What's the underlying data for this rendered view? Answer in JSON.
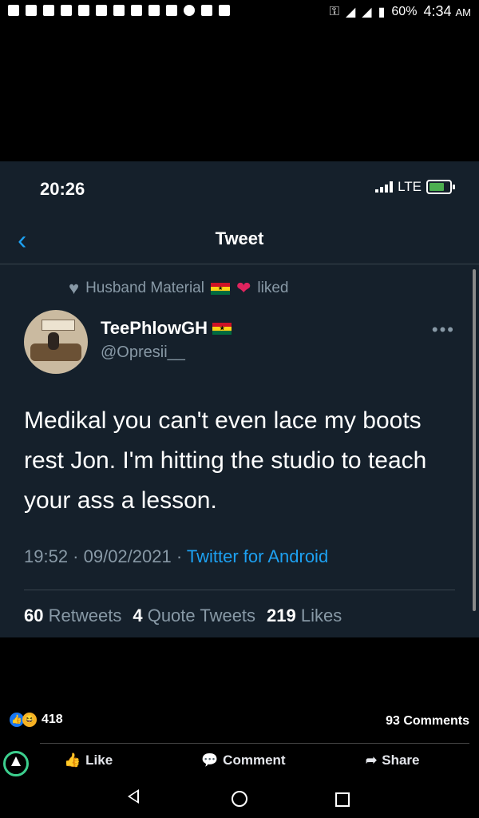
{
  "android_status": {
    "battery": "60%",
    "time": "4:34",
    "ampm": "AM"
  },
  "ios_status": {
    "time": "20:26",
    "network": "LTE"
  },
  "header": {
    "back_icon": "chevron-left-icon",
    "title": "Tweet"
  },
  "liked": {
    "name": "Husband Material",
    "action": "liked"
  },
  "user": {
    "name": "TeePhlowGH",
    "handle": "@Opresii__"
  },
  "tweet": {
    "text": "Medikal you can't even lace my boots rest Jon. I'm hitting the studio to teach your ass a lesson.",
    "time": "19:52 · 09/02/2021 · ",
    "source": "Twitter for Android"
  },
  "stats": {
    "retweets_count": "60",
    "retweets_label": "Retweets",
    "quotes_count": "4",
    "quotes_label": "Quote Tweets",
    "likes_count": "219",
    "likes_label": "Likes"
  },
  "fb": {
    "reactions_count": "418",
    "comments": "93 Comments",
    "like_label": "Like",
    "comment_label": "Comment",
    "share_label": "Share"
  },
  "colors": {
    "twitter_bg": "#15202b",
    "twitter_blue": "#1da1f2",
    "muted": "#8899a6",
    "heart": "#e0245e"
  }
}
